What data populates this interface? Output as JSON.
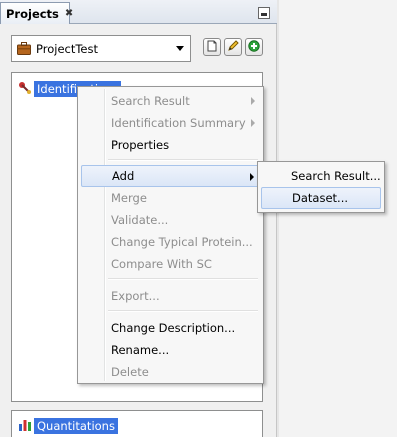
{
  "panel": {
    "tab_label": "Projects",
    "tab_close_glyph": "✖"
  },
  "project_combo": {
    "selected": "ProjectTest"
  },
  "toolbar": {
    "buttons": [
      {
        "icon": "new-document-icon"
      },
      {
        "icon": "edit-pencil-icon"
      },
      {
        "icon": "add-green-icon"
      }
    ]
  },
  "identification_tree": {
    "root_label": "Identifications"
  },
  "quantitation_tree": {
    "root_label": "Quantitations"
  },
  "context_menu": {
    "items": [
      {
        "label": "Search Result",
        "enabled": false,
        "submenu": true
      },
      {
        "label": "Identification Summary",
        "enabled": false,
        "submenu": true
      },
      {
        "label": "Properties",
        "enabled": true,
        "submenu": false
      },
      {
        "label": "Add",
        "enabled": true,
        "submenu": true,
        "active": true
      },
      {
        "label": "Merge",
        "enabled": false
      },
      {
        "label": "Validate...",
        "enabled": false
      },
      {
        "label": "Change Typical Protein...",
        "enabled": false
      },
      {
        "label": "Compare With SC",
        "enabled": false
      },
      {
        "label": "Export...",
        "enabled": false
      },
      {
        "label": "Change Description...",
        "enabled": true
      },
      {
        "label": "Rename...",
        "enabled": true
      },
      {
        "label": "Delete",
        "enabled": false
      }
    ]
  },
  "add_submenu": {
    "items": [
      {
        "label": "Search Result..."
      },
      {
        "label": "Dataset...",
        "hovered": true
      }
    ]
  },
  "colors": {
    "selection": "#3a73e0",
    "menu_hover": "#dbe6f7",
    "disabled_text": "#8d8d8d"
  }
}
